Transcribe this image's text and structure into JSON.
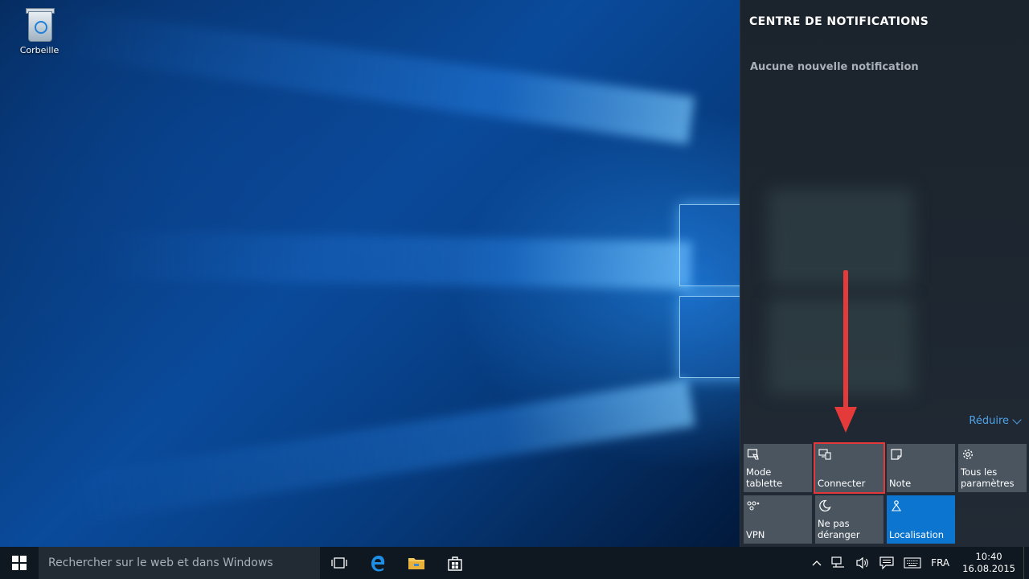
{
  "desktop": {
    "icons": [
      {
        "label": "Corbeille",
        "icon": "recycle-bin-icon"
      }
    ]
  },
  "action_center": {
    "title": "CENTRE DE NOTIFICATIONS",
    "empty_message": "Aucune nouvelle notification",
    "collapse_label": "Réduire",
    "quick_actions": [
      {
        "label": "Mode tablette",
        "icon": "tablet-mode-icon",
        "active": false
      },
      {
        "label": "Connecter",
        "icon": "connect-icon",
        "active": false,
        "highlighted": true
      },
      {
        "label": "Note",
        "icon": "note-icon",
        "active": false
      },
      {
        "label": "Tous les paramètres",
        "icon": "settings-gear-icon",
        "active": false
      },
      {
        "label": "VPN",
        "icon": "vpn-icon",
        "active": false
      },
      {
        "label": "Ne pas déranger",
        "icon": "moon-icon",
        "active": false
      },
      {
        "label": "Localisation",
        "icon": "location-icon",
        "active": true
      }
    ]
  },
  "annotation": {
    "arrow_color": "#e53a3a",
    "highlight_color": "#e5383b"
  },
  "taskbar": {
    "search_placeholder": "Rechercher sur le web et dans Windows",
    "pinned": [
      "task-view-icon",
      "edge-icon",
      "file-explorer-icon",
      "store-icon"
    ],
    "tray": {
      "language": "FRA",
      "time": "10:40",
      "date": "16.08.2015"
    }
  },
  "colors": {
    "accent": "#0b75cf",
    "tile": "#4a5560",
    "link": "#4fa3e8"
  }
}
